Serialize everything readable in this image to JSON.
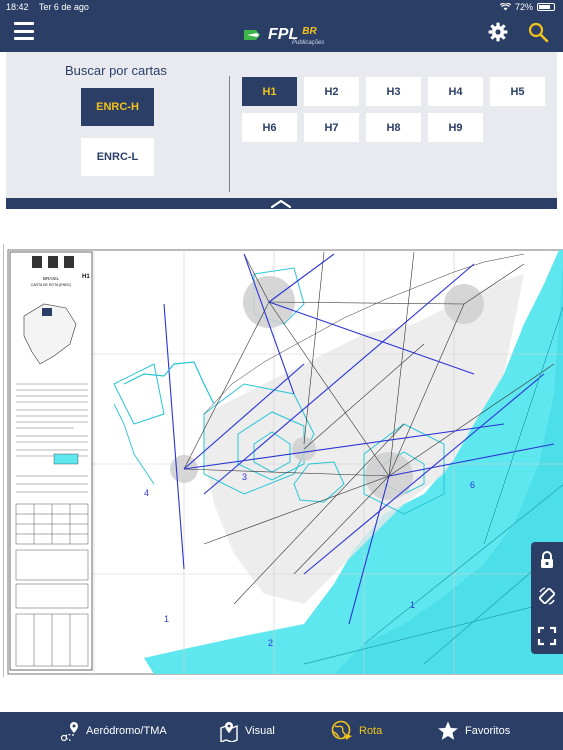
{
  "status_bar": {
    "time": "18:42",
    "date": "Ter 6 de ago",
    "battery": "72%"
  },
  "header": {
    "logo_text": "FPL",
    "logo_suffix": "BR",
    "logo_subtitle": "Publicações"
  },
  "selector": {
    "title": "Buscar por cartas",
    "types": [
      {
        "label": "ENRC-H",
        "selected": true
      },
      {
        "label": "ENRC-L",
        "selected": false
      }
    ],
    "charts": [
      {
        "label": "H1",
        "selected": true
      },
      {
        "label": "H2",
        "selected": false
      },
      {
        "label": "H3",
        "selected": false
      },
      {
        "label": "H4",
        "selected": false
      },
      {
        "label": "H5",
        "selected": false
      },
      {
        "label": "H6",
        "selected": false
      },
      {
        "label": "H7",
        "selected": false
      },
      {
        "label": "H8",
        "selected": false
      },
      {
        "label": "H9",
        "selected": false
      }
    ]
  },
  "map": {
    "legend_title": "BRASIL",
    "legend_subtitle": "CARTA DE ROTA (ENRC)",
    "chart_id": "H1",
    "sector_labels": [
      "4",
      "3",
      "1",
      "2",
      "6",
      "1"
    ]
  },
  "tabs": [
    {
      "label": "Aeródromo/TMA",
      "icon": "route-pin-icon",
      "active": false
    },
    {
      "label": "Visual",
      "icon": "map-pin-icon",
      "active": false
    },
    {
      "label": "Rota",
      "icon": "globe-route-icon",
      "active": true
    },
    {
      "label": "Favoritos",
      "icon": "star-icon",
      "active": false
    }
  ],
  "colors": {
    "primary": "#2b3f66",
    "accent": "#f2c21b",
    "panel": "#e8eaf0",
    "sea": "#5ee7ee"
  }
}
